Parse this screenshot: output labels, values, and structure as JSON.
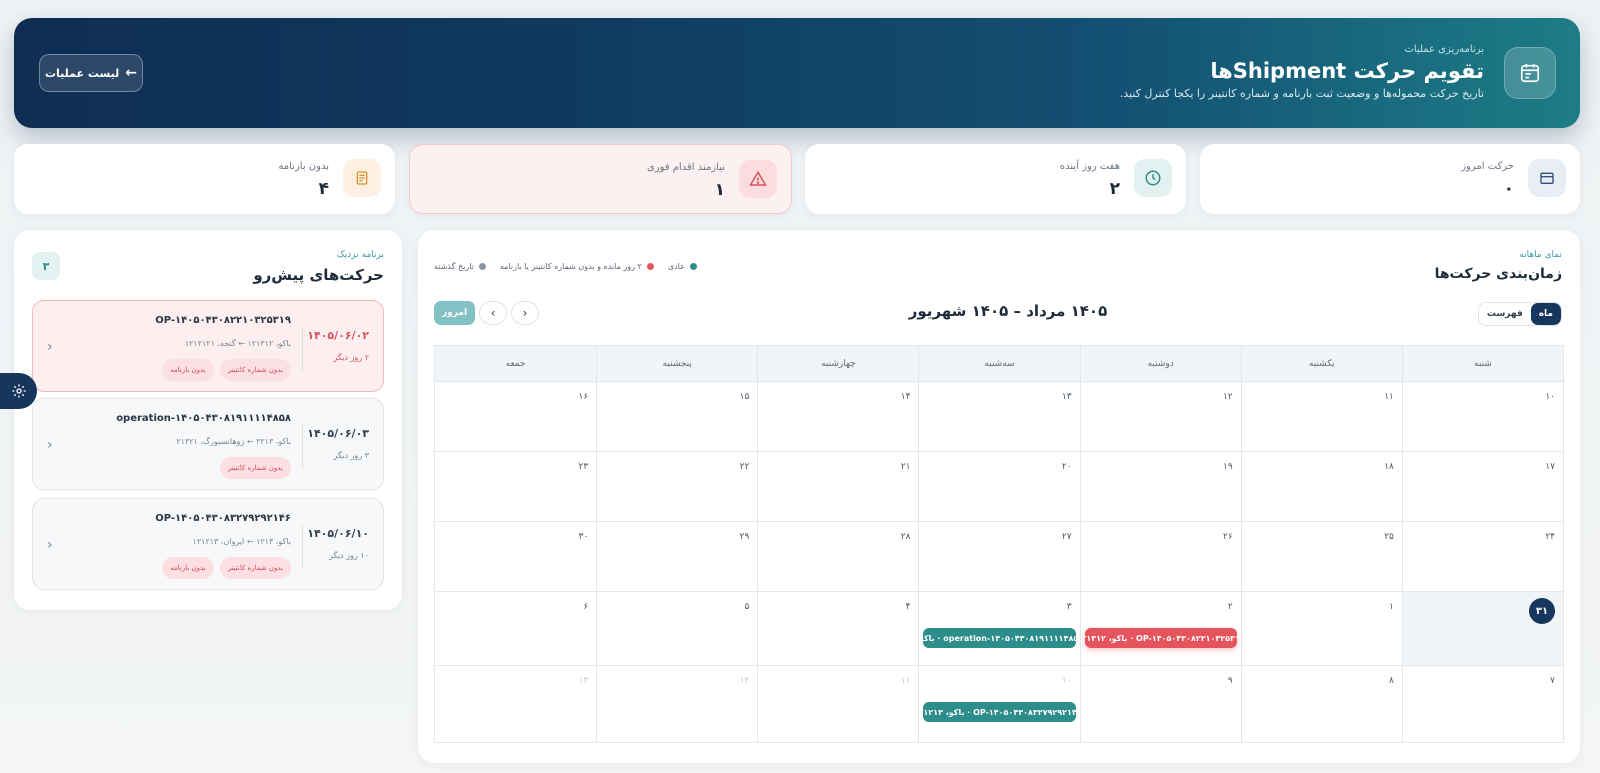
{
  "hero": {
    "kicker": "برنامه‌ریزی عملیات",
    "title": "تقویم حرکت Shipmentها",
    "subtitle": "تاریخ حرکت محموله‌ها و وضعیت ثبت بارنامه و شماره کانتینر را یکجا کنترل کنید.",
    "back_label": "لیست عملیات"
  },
  "stats": [
    {
      "label": "حرکت امروز",
      "value": "۰",
      "icon": "calendar-icon"
    },
    {
      "label": "هفت روز آینده",
      "value": "۲",
      "icon": "clock-icon"
    },
    {
      "label": "نیازمند اقدام فوری",
      "value": "۱",
      "icon": "warning-icon"
    },
    {
      "label": "بدون بارنامه",
      "value": "۴",
      "icon": "document-icon"
    }
  ],
  "upcoming": {
    "kicker": "برنامه نزدیک",
    "title": "حرکت‌های پیش‌رو",
    "count": "۳",
    "items": [
      {
        "date": "۱۴۰۵/۰۶/۰۲",
        "days": "۲ روز دیگر",
        "code": "OP-۱۴۰۵۰۴۳۰۸۲۲۱۰۳۲۵۳۱۹",
        "route": "باکو، ۱۲۱۳۱۲ ← گنجه، ۱۲۱۲۱۲۱",
        "tags": [
          "بدون شماره کانتینر",
          "بدون بارنامه"
        ]
      },
      {
        "date": "۱۴۰۵/۰۶/۰۳",
        "days": "۳ روز دیگر",
        "code": "operation-۱۴۰۵۰۴۳۰۸۱۹۱۱۱۱۴۸۵۸",
        "route": "باکو، ۳۲۱۳ ← ژوهانسبورگ، ۲۱۳۲۱",
        "tags": [
          "بدون شماره کانتینر"
        ]
      },
      {
        "date": "۱۴۰۵/۰۶/۱۰",
        "days": "۱۰ روز دیگر",
        "code": "OP-۱۴۰۵۰۴۳۰۸۳۲۷۹۲۹۲۱۴۶",
        "route": "باکو، ۱۲۱۳ ← ایروان، ۱۲۱۲۱۳",
        "tags": [
          "بدون شماره کانتینر",
          "بدون بارنامه"
        ]
      }
    ]
  },
  "calendar": {
    "kicker": "نمای ماهانه",
    "title": "زمان‌بندی حرکت‌ها",
    "period": "۱۴۰۵ مرداد – ۱۴۰۵ شهریور",
    "view_month": "ماه",
    "view_list": "فهرست",
    "today_label": "امروز",
    "legend": [
      {
        "label": "عادی",
        "color": "#2d8d8a"
      },
      {
        "label": "۲ روز مانده و بدون شماره کانتینر یا بارنامه",
        "color": "#e5545c"
      },
      {
        "label": "تاریخ گذشته",
        "color": "#8a97a8"
      }
    ],
    "weekdays": [
      "شنبه",
      "یکشنبه",
      "دوشنبه",
      "سه‌شنبه",
      "چهارشنبه",
      "پنجشنبه",
      "جمعه"
    ],
    "weeks": [
      {
        "days": [
          {
            "n": "۱۰"
          },
          {
            "n": "۱۱"
          },
          {
            "n": "۱۲"
          },
          {
            "n": "۱۳"
          },
          {
            "n": "۱۴"
          },
          {
            "n": "۱۵"
          },
          {
            "n": "۱۶"
          }
        ]
      },
      {
        "days": [
          {
            "n": "۱۷"
          },
          {
            "n": "۱۸"
          },
          {
            "n": "۱۹"
          },
          {
            "n": "۲۰"
          },
          {
            "n": "۲۱"
          },
          {
            "n": "۲۲"
          },
          {
            "n": "۲۳"
          }
        ]
      },
      {
        "days": [
          {
            "n": "۲۴"
          },
          {
            "n": "۲۵"
          },
          {
            "n": "۲۶"
          },
          {
            "n": "۲۷"
          },
          {
            "n": "۲۸"
          },
          {
            "n": "۲۹"
          },
          {
            "n": "۳۰"
          }
        ]
      },
      {
        "days": [
          {
            "n": "۳۱",
            "today": true
          },
          {
            "n": "۱"
          },
          {
            "n": "۲",
            "event": {
              "text": "OP-۱۴۰۵۰۴۳۰۸۲۲۱۰۳۲۵۳۱۹ · باکو، ۱۲۱۳۱۲",
              "kind": "red"
            }
          },
          {
            "n": "۳",
            "event": {
              "text": "operation-۱۴۰۵۰۴۳۰۸۱۹۱۱۱۱۴۸۵۸ · باکو،",
              "kind": "teal"
            }
          },
          {
            "n": "۴"
          },
          {
            "n": "۵"
          },
          {
            "n": "۶"
          }
        ]
      },
      {
        "days": [
          {
            "n": "۷"
          },
          {
            "n": "۸"
          },
          {
            "n": "۹"
          },
          {
            "n": "۱۰",
            "muted": true,
            "event": {
              "text": "OP-۱۴۰۵۰۴۳۰۸۳۲۷۹۲۹۲۱۴۶ · باکو، ۱۲۱۳ -",
              "kind": "teal"
            }
          },
          {
            "n": "۱۱",
            "muted": true
          },
          {
            "n": "۱۲",
            "muted": true
          },
          {
            "n": "۱۳",
            "muted": true
          }
        ]
      }
    ]
  }
}
